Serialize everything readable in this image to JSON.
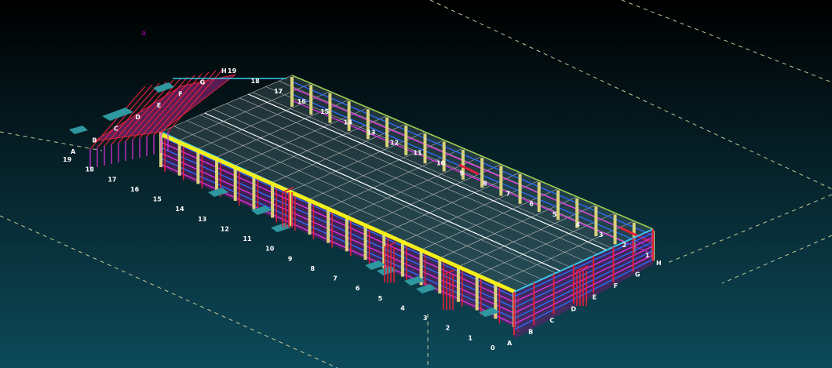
{
  "viewport": {
    "background_top": "#000000",
    "background_bottom": "#0d4a5a",
    "corner_marker": "a"
  },
  "colors": {
    "frame_magenta": "#e030e0",
    "frame_red": "#e0203a",
    "frame_blue": "#2a6cff",
    "crane_yellow": "#f4ef1a",
    "column_yellow": "#d8d27a",
    "roof_grid": "#b8b8b8",
    "eave_cyan": "#39c9ee",
    "canopy_teal": "#2e97a0",
    "grid_line": "#c6c89a",
    "label": "#ffffff"
  },
  "grid_labels": {
    "left_axis_numbers": [
      "19",
      "18",
      "17",
      "16",
      "15",
      "14",
      "13",
      "12",
      "11",
      "10",
      "9",
      "8",
      "7",
      "6",
      "5",
      "4",
      "3",
      "2",
      "1",
      "0"
    ],
    "front_letters": [
      "A",
      "B",
      "C",
      "D",
      "E",
      "F",
      "G",
      "H"
    ],
    "back_axis_numbers": [
      "19",
      "18",
      "17",
      "16",
      "15",
      "14",
      "13",
      "12",
      "11",
      "10",
      "9",
      "8",
      "7",
      "6",
      "5",
      "4",
      "3",
      "2",
      "1"
    ],
    "right_end_letters": [
      "A",
      "B",
      "C",
      "D",
      "E",
      "F",
      "G",
      "H"
    ],
    "top_letters": [
      "A",
      "B",
      "C",
      "D",
      "E",
      "F",
      "G",
      "H"
    ]
  }
}
